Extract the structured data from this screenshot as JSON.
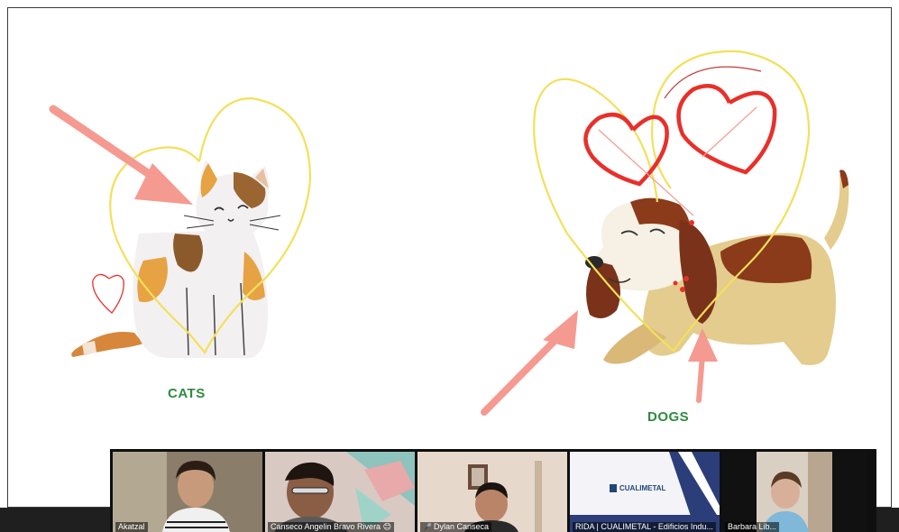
{
  "slide": {
    "label_cats": "CATS",
    "label_dogs": "DOGS"
  },
  "participants": [
    {
      "name": "Akatzal"
    },
    {
      "name": "Canseco Angelin Bravo Rivera"
    },
    {
      "name": "Dylan Canseca",
      "muted": true
    },
    {
      "name": "RIDA | CUALIMETAL - Edificios Indu..."
    },
    {
      "name": "Barbara Lib..."
    }
  ],
  "share_screen": {
    "logo_text": "CUALIMETAL"
  },
  "colors": {
    "label_green": "#2e8b3e",
    "heart_yellow": "#f3e05a",
    "heart_red": "#e8302a",
    "arrow_pink": "#f59a90"
  }
}
